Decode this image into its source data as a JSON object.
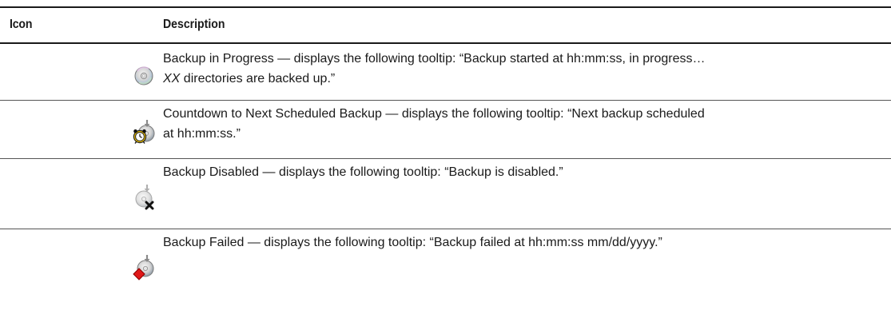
{
  "table": {
    "headers": {
      "icon": "Icon",
      "description": "Description"
    },
    "rows": [
      {
        "icon": "disc-icon",
        "description": "Backup in Progress — displays the following tooltip: “Backup started at hh:mm:ss, in progress…",
        "description_em": "XX",
        "description_tail": " directories are backed up.”"
      },
      {
        "icon": "alarm-clock-disc-icon",
        "description": "Countdown to Next Scheduled Backup — displays the following tooltip: “Next backup scheduled",
        "description_line2": "at hh:mm:ss.”"
      },
      {
        "icon": "disc-disabled-icon",
        "description": "Backup Disabled — displays the following tooltip: “Backup is disabled.”"
      },
      {
        "icon": "disc-failed-icon",
        "description": "Backup Failed — displays the following tooltip: “Backup failed at hh:mm:ss mm/dd/yyyy.”"
      }
    ]
  }
}
